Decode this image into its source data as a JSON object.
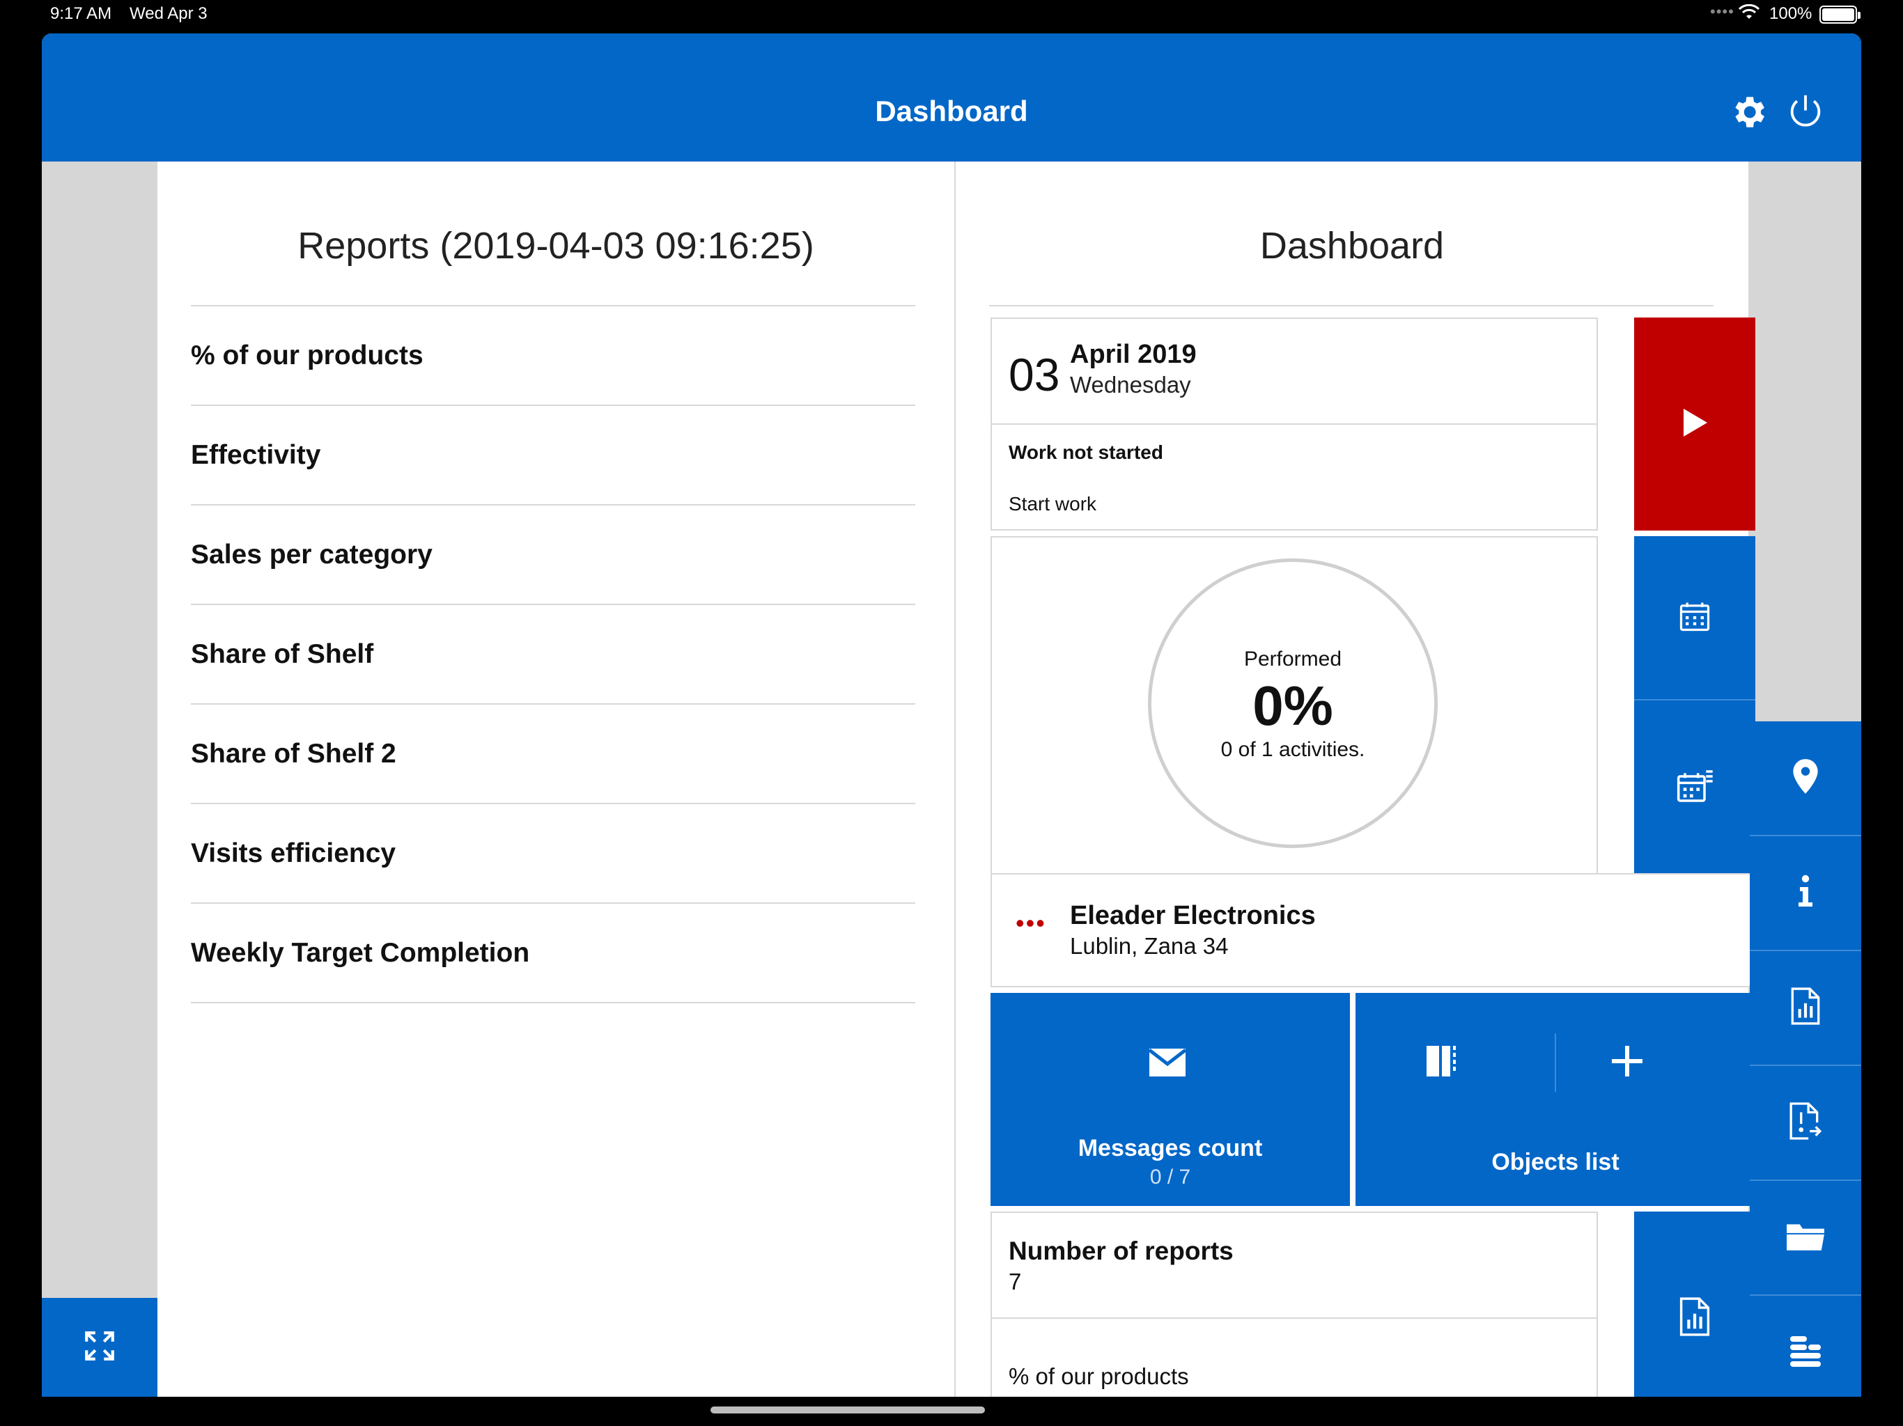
{
  "status_bar": {
    "time": "9:17 AM",
    "date": "Wed Apr 3",
    "battery": "100%"
  },
  "header": {
    "title": "Dashboard",
    "settings_icon": "gear-icon",
    "power_icon": "power-icon"
  },
  "reports_panel": {
    "title": "Reports (2019-04-03 09:16:25)",
    "items": [
      {
        "label": "% of our products"
      },
      {
        "label": "Effectivity"
      },
      {
        "label": "Sales per category"
      },
      {
        "label": "Share of Shelf"
      },
      {
        "label": "Share of Shelf 2"
      },
      {
        "label": "Visits efficiency"
      },
      {
        "label": "Weekly Target Completion"
      }
    ],
    "expand_icon": "expand-icon"
  },
  "dashboard_panel": {
    "title": "Dashboard",
    "date_card": {
      "day": "03",
      "month_year": "April 2019",
      "weekday": "Wednesday",
      "work_status": "Work not started",
      "action": "Start work",
      "start_color": "#c00000",
      "play_icon": "play-icon"
    },
    "performed_card": {
      "label": "Performed",
      "percent": "0%",
      "activities": "0 of 1 activities.",
      "calendar_icon": "calendar-icon",
      "calendar_list_icon": "calendar-list-icon"
    },
    "location_card": {
      "name": "Eleader Electronics",
      "address": "Lublin, Zana 34",
      "more_icon": "more-dots-icon"
    },
    "messages_tile": {
      "label": "Messages count",
      "value": "0 / 7",
      "icon": "envelope-icon"
    },
    "objects_tile": {
      "label": "Objects list",
      "barcode_icon": "barcode-icon",
      "add_icon": "plus-icon"
    },
    "reports_card": {
      "label": "Number of reports",
      "value": "7",
      "report_name": "% of our products",
      "icon": "report-chart-icon"
    }
  },
  "right_nav": [
    {
      "icon": "location-pin-icon"
    },
    {
      "icon": "info-icon"
    },
    {
      "icon": "report-chart-icon"
    },
    {
      "icon": "report-alert-icon"
    },
    {
      "icon": "folder-icon"
    },
    {
      "icon": "database-icon"
    }
  ],
  "colors": {
    "primary": "#0367c8",
    "danger": "#c00000",
    "border": "#d8d8d8"
  }
}
